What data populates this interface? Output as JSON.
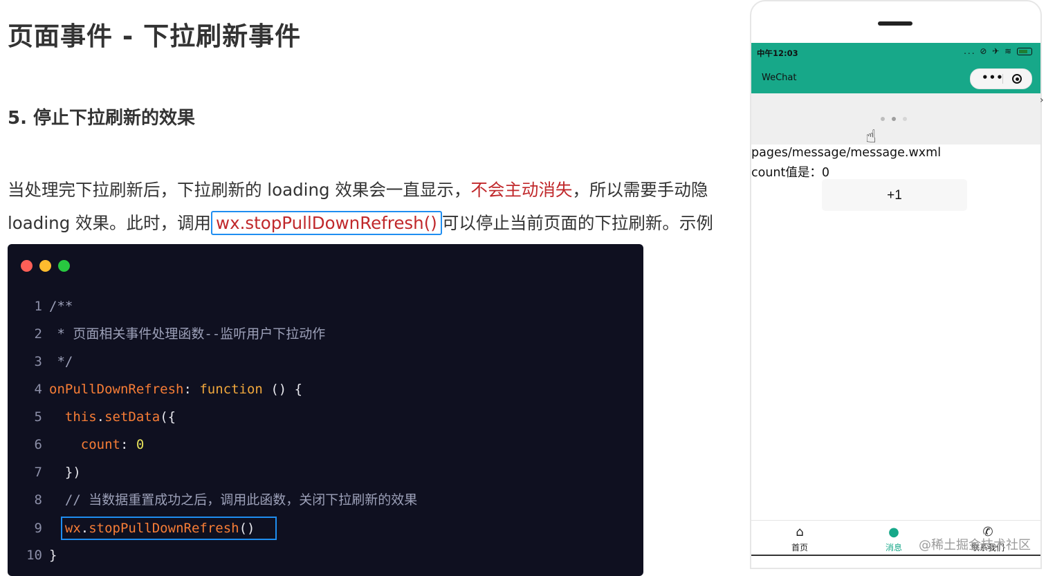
{
  "slide": {
    "title": "页面事件 - 下拉刷新事件",
    "subtitle": "5. 停止下拉刷新的效果",
    "para_line1_a": "当处理完下拉刷新后，下拉刷新的 loading 效果会一直显示，",
    "para_line1_red": "不会主动消失",
    "para_line1_b": "，所以需要手动隐",
    "para_line2_a": "loading 效果。此时，调用",
    "para_line2_code": "wx.stopPullDownRefresh()",
    "para_line2_b": "可以停止当前页面的下拉刷新。示例"
  },
  "code": {
    "lines": [
      {
        "n": "1",
        "t1": "/**"
      },
      {
        "n": "2",
        "t1": " * 页面相关事件处理函数--监听用户下拉动作"
      },
      {
        "n": "3",
        "t1": " */"
      },
      {
        "n": "4",
        "fn": "onPullDownRefresh",
        "colon": ": ",
        "kw": "function",
        "rest": " () {"
      },
      {
        "n": "5",
        "this": "this",
        "dot": ".",
        "fn": "setData",
        "rest": "({"
      },
      {
        "n": "6",
        "fn": "count",
        "colon": ": ",
        "num": "0"
      },
      {
        "n": "7",
        "rest": "})"
      },
      {
        "n": "8",
        "t1": "// 当数据重置成功之后，调用此函数，关闭下拉刷新的效果"
      },
      {
        "n": "9",
        "obj": "wx",
        "dot": ".",
        "fn": "stopPullDownRefresh",
        "rest": "()"
      },
      {
        "n": "10",
        "rest": "}"
      }
    ]
  },
  "phone": {
    "time": "中午12:03",
    "status_icons": "... ⊘ ✈ ≋",
    "nav_title": "WeChat",
    "capsule_menu": "•••",
    "page_path": "pages/message/message.wxml",
    "count_label": "count值是：0",
    "plus_button": "+1",
    "tabs": [
      {
        "label": "首页",
        "icon": "⌂"
      },
      {
        "label": "消息",
        "icon": "●"
      },
      {
        "label": "联系我们",
        "icon": "✆"
      }
    ]
  },
  "watermark": "@稀土掘金技术社区",
  "colors": {
    "accent_red": "#c0282b",
    "highlight_blue": "#1f8ef1",
    "wechat_green": "#17a889",
    "code_bg": "#0f1020"
  }
}
